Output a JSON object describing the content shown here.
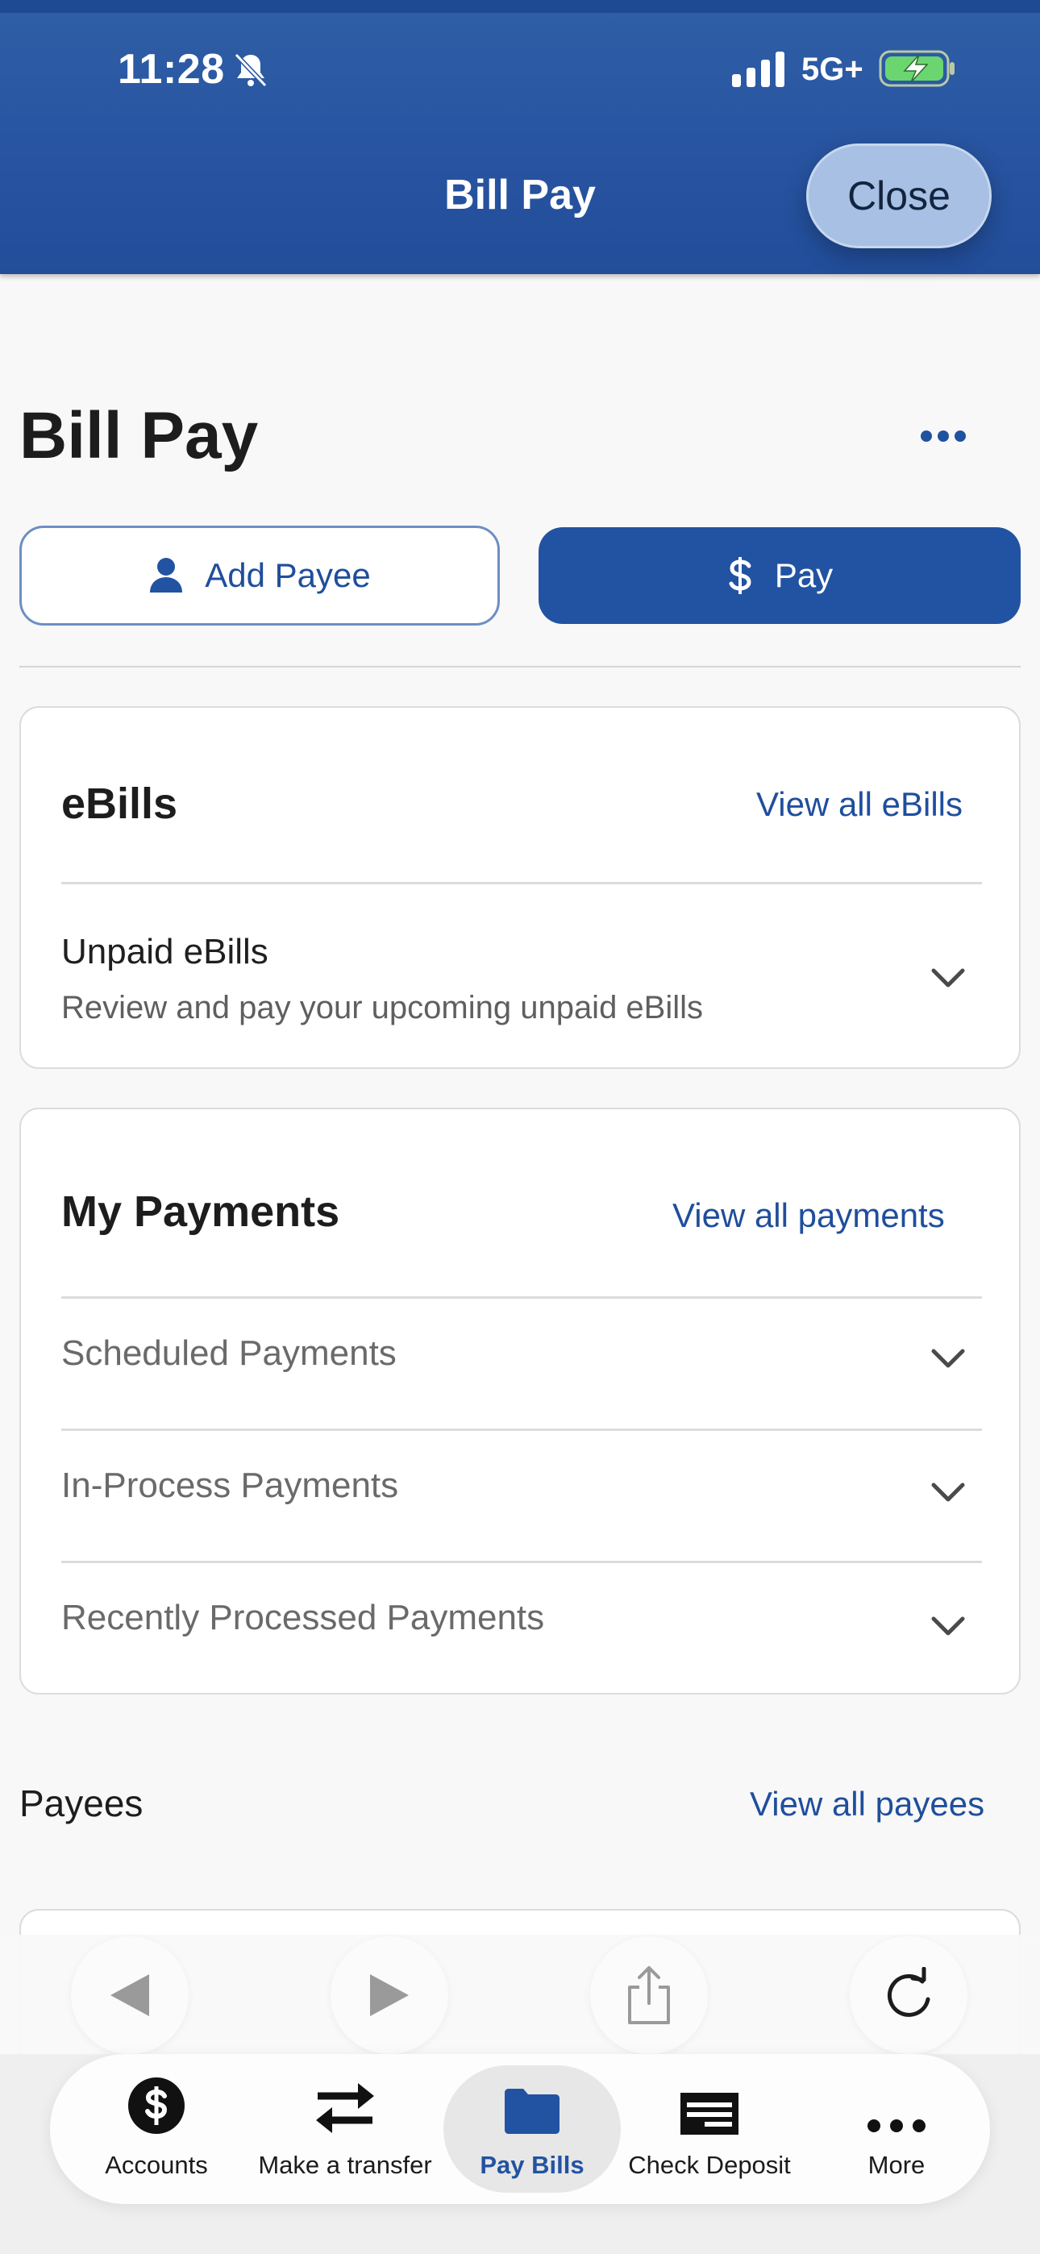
{
  "status_bar": {
    "time": "11:28",
    "network": "5G+"
  },
  "nav": {
    "title": "Bill Pay",
    "close_label": "Close"
  },
  "page": {
    "title": "Bill Pay"
  },
  "actions": {
    "add_payee_label": "Add Payee",
    "pay_label": "Pay"
  },
  "ebills": {
    "title": "eBills",
    "view_all": "View all eBills",
    "unpaid_title": "Unpaid eBills",
    "unpaid_subtitle": "Review and pay your upcoming unpaid eBills"
  },
  "payments": {
    "title": "My Payments",
    "view_all": "View all payments",
    "rows": [
      "Scheduled Payments",
      "In-Process Payments",
      "Recently Processed Payments"
    ]
  },
  "payees": {
    "title": "Payees",
    "view_all": "View all payees"
  },
  "tabs": [
    {
      "label": "Accounts",
      "icon": "dollar-circle-icon"
    },
    {
      "label": "Make a transfer",
      "icon": "transfer-arrows-icon"
    },
    {
      "label": "Pay Bills",
      "icon": "folder-icon"
    },
    {
      "label": "Check Deposit",
      "icon": "check-icon"
    },
    {
      "label": "More",
      "icon": "more-dots-icon"
    }
  ],
  "colors": {
    "header_blue": "#2753a0",
    "accent_blue": "#2253a2",
    "link_blue": "#1f4e9c",
    "close_button": "#a7c0e3",
    "battery_green": "#6bd66f"
  }
}
